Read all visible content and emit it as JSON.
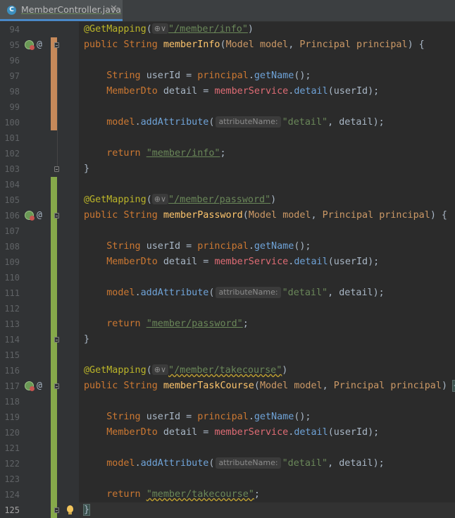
{
  "tab": {
    "label": "MemberController.java",
    "icon": "class-icon",
    "close": "✕"
  },
  "editor": {
    "current_line": "125",
    "lines": [
      {
        "n": "94"
      },
      {
        "n": "95"
      },
      {
        "n": "96"
      },
      {
        "n": "97"
      },
      {
        "n": "98"
      },
      {
        "n": "99"
      },
      {
        "n": "100"
      },
      {
        "n": "101"
      },
      {
        "n": "102"
      },
      {
        "n": "103"
      },
      {
        "n": "104"
      },
      {
        "n": "105"
      },
      {
        "n": "106"
      },
      {
        "n": "107"
      },
      {
        "n": "108"
      },
      {
        "n": "109"
      },
      {
        "n": "110"
      },
      {
        "n": "111"
      },
      {
        "n": "112"
      },
      {
        "n": "113"
      },
      {
        "n": "114"
      },
      {
        "n": "115"
      },
      {
        "n": "116"
      },
      {
        "n": "117"
      },
      {
        "n": "118"
      },
      {
        "n": "119"
      },
      {
        "n": "120"
      },
      {
        "n": "121"
      },
      {
        "n": "122"
      },
      {
        "n": "123"
      },
      {
        "n": "124"
      },
      {
        "n": "125"
      }
    ],
    "hint_label": "attributeName:",
    "globe_hint": "⊕∨",
    "code": {
      "ann_get_mapping": "@GetMapping",
      "kw_public": "public",
      "kw_return": "return",
      "type_string": "String",
      "type_model": "Model",
      "type_principal": "Principal",
      "type_member_dto": "MemberDto",
      "var_model": "model",
      "var_principal": "principal",
      "var_user_id": "userId",
      "var_detail": "detail",
      "var_member_service": "memberService",
      "m_get_name": "getName",
      "m_detail": "detail",
      "m_add_attribute": "addAttribute",
      "str_detail": "\"detail\"",
      "m1": {
        "path": "\"/member/info\"",
        "name": "memberInfo",
        "view": "\"member/info\""
      },
      "m2": {
        "path": "\"/member/password\"",
        "name": "memberPassword",
        "view": "\"member/password\""
      },
      "m3": {
        "path": "\"/member/takecourse\"",
        "name": "memberTaskCourse",
        "view": "\"member/takecourse\""
      }
    },
    "colors": {
      "keyword": "#cc7832",
      "string": "#6a8759",
      "annotation": "#bbb529",
      "modified": "#c6895a",
      "added": "#86a94a"
    }
  }
}
